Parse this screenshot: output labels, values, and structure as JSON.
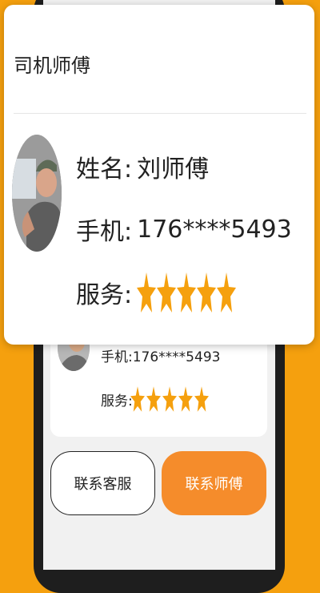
{
  "background_card": {
    "phone_label": "手机:",
    "phone_value": "176****5493",
    "service_label": "服务:",
    "service_rating": 5,
    "rating_max": 5
  },
  "buttons": {
    "contact_service": "联系客服",
    "contact_driver": "联系师傅"
  },
  "popup": {
    "title": "司机师傅",
    "name_label": "姓名:",
    "name_value": "刘师傅",
    "phone_label": "手机:",
    "phone_value": "176****5493",
    "service_label": "服务:",
    "service_rating": 5,
    "rating_max": 5
  },
  "colors": {
    "background": "#F5A00E",
    "star": "#F5A00E",
    "primary_button": "#F58C2B"
  },
  "icons": [
    "driver-avatar",
    "star-icon"
  ]
}
